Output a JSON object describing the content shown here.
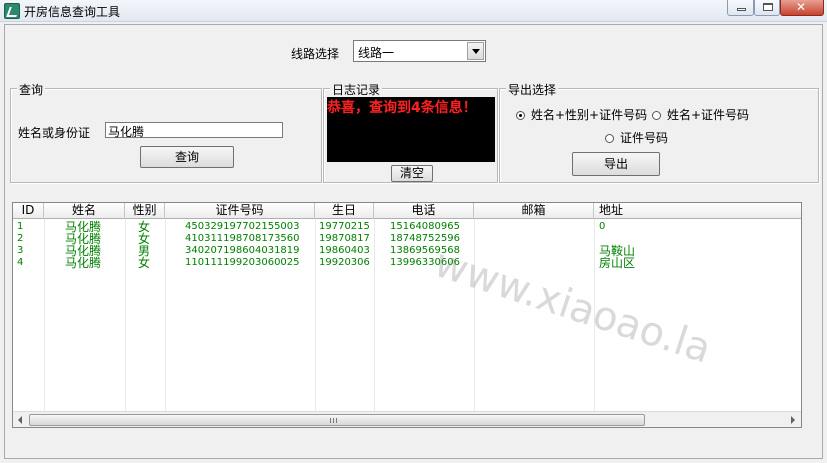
{
  "window": {
    "title": "开房信息查询工具"
  },
  "route": {
    "label": "线路选择",
    "selected": "线路一"
  },
  "query": {
    "group_title": "查询",
    "field_label": "姓名或身份证",
    "field_value": "马化腾",
    "button_label": "查询"
  },
  "log": {
    "group_title": "日志记录",
    "message": "恭喜，查询到4条信息！",
    "clear_label": "清空"
  },
  "export": {
    "group_title": "导出选择",
    "options": [
      {
        "label": "姓名+性别+证件号码",
        "selected": true
      },
      {
        "label": "姓名+证件号码",
        "selected": false
      },
      {
        "label": "证件号码",
        "selected": false
      }
    ],
    "button_label": "导出"
  },
  "table": {
    "columns": [
      "ID",
      "姓名",
      "性别",
      "证件号码",
      "生日",
      "电话",
      "邮箱",
      "地址"
    ],
    "rows": [
      [
        "1",
        "马化腾",
        "女",
        "450329197702155003",
        "19770215",
        "15164080965",
        "",
        "0"
      ],
      [
        "2",
        "马化腾",
        "女",
        "410311198708173560",
        "19870817",
        "18748752596",
        "",
        ""
      ],
      [
        "3",
        "马化腾",
        "男",
        "340207198604031819",
        "19860403",
        "13869569568",
        "",
        "马鞍山"
      ],
      [
        "4",
        "马化腾",
        "女",
        "110111199203060025",
        "19920306",
        "13996330606",
        "",
        "房山区"
      ]
    ]
  },
  "watermark": "www.xiaoao.la",
  "colors": {
    "row_text": "#008000",
    "log_text": "#ff2020",
    "log_bg": "#000000"
  },
  "icons": {
    "app": "app-icon",
    "min": "minimize-icon",
    "max": "maximize-icon",
    "close": "close-icon"
  }
}
